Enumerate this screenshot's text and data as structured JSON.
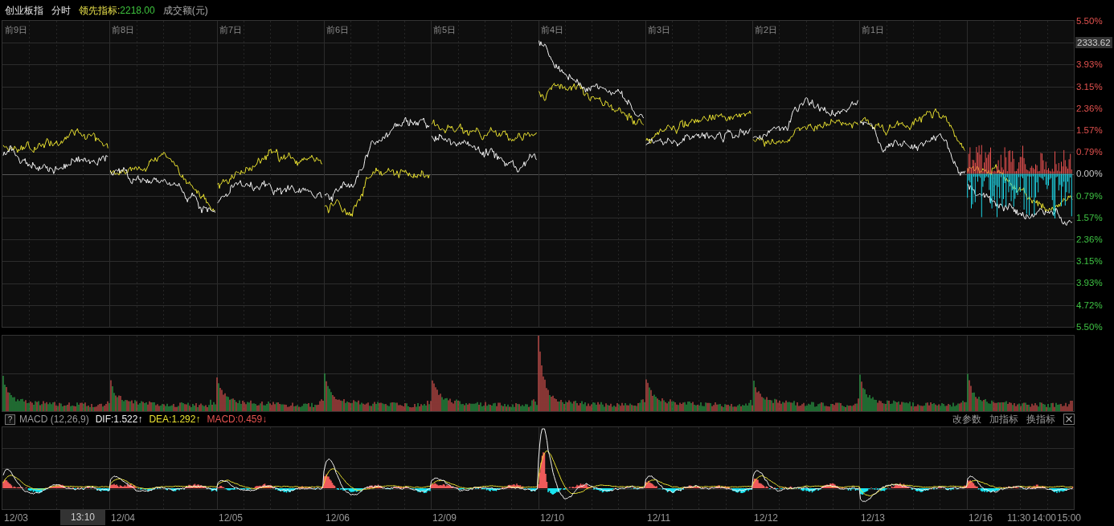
{
  "header": {
    "title": "创业板指",
    "mode": "分时",
    "indicator_label": "领先指标:",
    "indicator_value": "2218.00",
    "volume_label": "成交额(元)"
  },
  "main_chart": {
    "day_labels": [
      "前9日",
      "前8日",
      "前7日",
      "前6日",
      "前5日",
      "前4日",
      "前3日",
      "前2日",
      "前1日"
    ],
    "y_axis": [
      {
        "text": "5.50%",
        "kind": "up"
      },
      {
        "text": "2333.62",
        "kind": "price"
      },
      {
        "text": "3.93%",
        "kind": "up"
      },
      {
        "text": "3.15%",
        "kind": "up"
      },
      {
        "text": "2.36%",
        "kind": "up"
      },
      {
        "text": "1.57%",
        "kind": "up"
      },
      {
        "text": "0.79%",
        "kind": "up"
      },
      {
        "text": "0.00%",
        "kind": "flat"
      },
      {
        "text": "0.79%",
        "kind": "down"
      },
      {
        "text": "1.57%",
        "kind": "down"
      },
      {
        "text": "2.36%",
        "kind": "down"
      },
      {
        "text": "3.15%",
        "kind": "down"
      },
      {
        "text": "3.93%",
        "kind": "down"
      },
      {
        "text": "4.72%",
        "kind": "down"
      },
      {
        "text": "5.50%",
        "kind": "down"
      }
    ]
  },
  "macd": {
    "help": "?",
    "title": "MACD (12,26,9)",
    "dif": "DIF:1.522↑",
    "dea": "DEA:1.292↑",
    "macd": "MACD:0.459↓",
    "buttons": [
      "改参数",
      "加指标",
      "换指标"
    ]
  },
  "time_axis": {
    "dates": [
      "12/03",
      "12/04",
      "12/05",
      "12/06",
      "12/09",
      "12/10",
      "12/11",
      "12/12",
      "12/13",
      "12/16"
    ],
    "cursor_time": "13:10",
    "times": [
      "11:30",
      "14:00",
      "15:00"
    ]
  }
}
